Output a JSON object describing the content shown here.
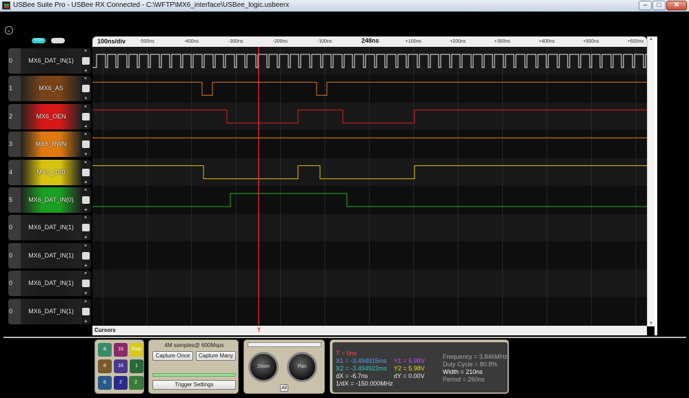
{
  "window": {
    "title": "USBee Suite Pro - USBee RX Connected - C:\\WFTP\\MX6_interface\\USBee_logic.usbeerx",
    "min": "–",
    "max": "□",
    "close": "✕"
  },
  "nav": {
    "prev_label": "<<<",
    "next_label": ""
  },
  "timeline": {
    "div_label": "100ns/div",
    "center_label": "248ns",
    "ticks": [
      "-500ns",
      "-400ns",
      "-300ns",
      "-200ns",
      "-100ns",
      "+100ns",
      "+200ns",
      "+300ns",
      "+400ns",
      "+500ns",
      "+600ns"
    ]
  },
  "channels": [
    {
      "index": "0",
      "name": "MX6_DAT_IN(1)",
      "color": "#f0f0f0",
      "bg": "#1c1c1c"
    },
    {
      "index": "1",
      "name": "MX6_AS",
      "color": "#d87a28",
      "bg": "#7a4418"
    },
    {
      "index": "2",
      "name": "MX6_OEN",
      "color": "#e02020",
      "bg": "#d81818"
    },
    {
      "index": "3",
      "name": "MX6_RWN",
      "color": "#f08c1c",
      "bg": "#e07a10"
    },
    {
      "index": "4",
      "name": "MX6_CS0",
      "color": "#e8c020",
      "bg": "#d8c410"
    },
    {
      "index": "5",
      "name": "MX6_DAT_IN(0)",
      "color": "#20b030",
      "bg": "#1aa020"
    },
    {
      "index": "0",
      "name": "MX6_DAT_IN(1)",
      "color": "#f0f0f0",
      "bg": "#1c1c1c"
    },
    {
      "index": "0",
      "name": "MX6_DAT_IN(1)",
      "color": "#f0f0f0",
      "bg": "#1c1c1c"
    },
    {
      "index": "0",
      "name": "MX6_DAT_IN(1)",
      "color": "#f0f0f0",
      "bg": "#1c1c1c"
    },
    {
      "index": "0",
      "name": "MX6_DAT_IN(1)",
      "color": "#f0f0f0",
      "bg": "#1c1c1c"
    }
  ],
  "cursors": {
    "label": "Cursors",
    "t_marker": "T"
  },
  "modes": [
    "8",
    "16",
    "Fast",
    "8",
    "16",
    "1",
    "8",
    "2",
    "1",
    "2"
  ],
  "capture": {
    "samples": "4M samples@ 600Msps",
    "once": "Capture Once",
    "many": "Capture Many",
    "trigger": "Trigger Settings"
  },
  "knobs": {
    "zoom": "Zoom",
    "pan": "Pan",
    "all": "All"
  },
  "measurements": {
    "t": "T = 0ns",
    "x1": "X1 = -3.494915ms",
    "x2": "X2 = -3.494922ms",
    "dx": "dX = -6.7ns",
    "inv_dx": "1/dX = -150.000MHz",
    "y1": "Y1 = 5.98V",
    "y2": "Y2 = 5.98V",
    "dy": "dY = 0.00V",
    "freq": "Frequency = 3.846MHz",
    "duty": "Duty Cycle = 80.8%",
    "width": "Width = 210ns",
    "period": "Period = 260ns"
  },
  "colors": {
    "cursor": "#ff3030",
    "x1": "#4aa3ff",
    "x2": "#36c7c7",
    "y1": "#c84cff",
    "y2": "#e8e020"
  }
}
